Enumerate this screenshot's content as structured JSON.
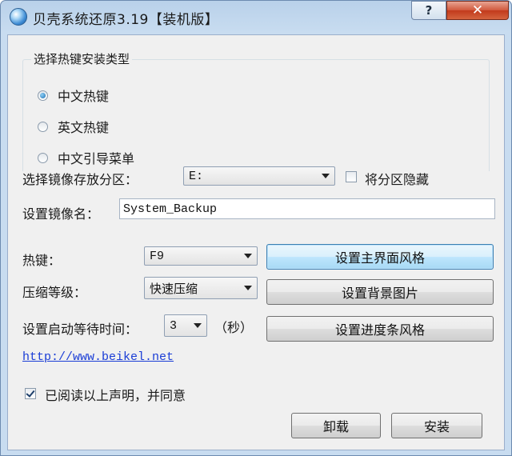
{
  "window": {
    "title": "贝壳系统还原3.19【装机版】",
    "help_label": "?",
    "close_label": "✕"
  },
  "install_type": {
    "group_title": "选择热键安装类型",
    "options": [
      {
        "label": "中文热键",
        "checked": true
      },
      {
        "label": "英文热键",
        "checked": false
      },
      {
        "label": "中文引导菜单",
        "checked": false
      }
    ]
  },
  "partition": {
    "label": "选择镜像存放分区：",
    "selected": "E:",
    "hide_label": "将分区隐藏",
    "hide_checked": false
  },
  "image_name": {
    "label": "设置镜像名：",
    "value": "System_Backup"
  },
  "hotkey": {
    "label": "热键：",
    "selected": "F9"
  },
  "compression": {
    "label": "压缩等级：",
    "selected": "快速压缩"
  },
  "wait_time": {
    "label": "设置启动等待时间：",
    "selected": "3",
    "unit": "（秒）"
  },
  "style_buttons": {
    "main_ui": "设置主界面风格",
    "background": "设置背景图片",
    "progress": "设置进度条风格"
  },
  "link": "http://www.beikel.net",
  "agreement": {
    "label": "已阅读以上声明，并同意",
    "checked": true
  },
  "actions": {
    "uninstall": "卸载",
    "install": "安装"
  },
  "colors": {
    "link": "#1a3dd6",
    "close_button": "#c23a1c",
    "focused_button": "#3c7fb1"
  }
}
